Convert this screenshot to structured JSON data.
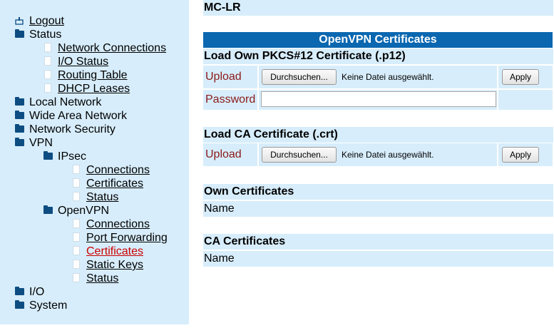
{
  "nav": {
    "logout": "Logout",
    "status": "Status",
    "network_connections": "Network Connections",
    "io_status": "I/O Status",
    "routing_table": "Routing Table",
    "dhcp_leases": "DHCP Leases",
    "local_network": "Local Network",
    "wide_area_network": "Wide Area Network",
    "network_security": "Network Security",
    "vpn": "VPN",
    "ipsec": "IPsec",
    "ipsec_connections": "Connections",
    "ipsec_certificates": "Certificates",
    "ipsec_status": "Status",
    "openvpn": "OpenVPN",
    "openvpn_connections": "Connections",
    "openvpn_port_forwarding": "Port Forwarding",
    "openvpn_certificates": "Certificates",
    "openvpn_static_keys": "Static Keys",
    "openvpn_status": "Status",
    "io": "I/O",
    "system": "System"
  },
  "main": {
    "device": "MC-LR",
    "section_title": "OpenVPN Certificates",
    "load_own": {
      "title": "Load Own PKCS#12 Certificate (.p12)",
      "upload_label": "Upload",
      "browse_label": "Durchsuchen...",
      "file_status": "Keine Datei ausgewählt.",
      "apply_label": "Apply",
      "password_label": "Password",
      "password_value": ""
    },
    "load_ca": {
      "title": "Load CA Certificate (.crt)",
      "upload_label": "Upload",
      "browse_label": "Durchsuchen...",
      "file_status": "Keine Datei ausgewählt.",
      "apply_label": "Apply"
    },
    "own_certs": {
      "title": "Own Certificates",
      "col_name": "Name"
    },
    "ca_certs": {
      "title": "CA Certificates",
      "col_name": "Name"
    }
  },
  "colors": {
    "sidebar_bg": "#d7edfb",
    "header_bg": "#0a67b0",
    "active_link": "#cc0000",
    "label_text": "#8b1a1a"
  }
}
